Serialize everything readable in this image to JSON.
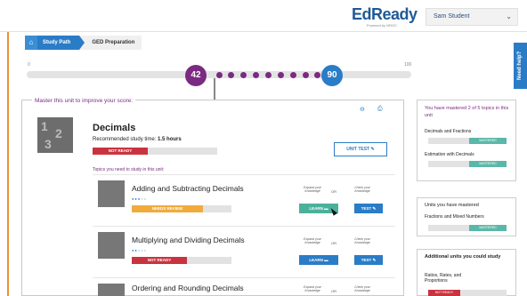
{
  "header": {
    "logo": "EdReady",
    "logo_sub": "Powered by NROC",
    "user_name": "Sam Student",
    "user_chevron_icon": "chevron-down-icon"
  },
  "breadcrumb": {
    "home_icon": "home-icon",
    "path": "Study Path",
    "current": "GED Preparation"
  },
  "need_help": "Need help?",
  "progress": {
    "min_label": "0",
    "max_label": "100",
    "current_score": "42",
    "target_score": "90",
    "marker_count": 9
  },
  "master_panel": {
    "title": "Master this unit to improve your score:",
    "unit_name": "Decimals",
    "study_time_label": "Recommended study time:",
    "study_time_value": "1.5 hours",
    "status": "NOT READY",
    "unit_test_label": "UNIT TEST",
    "topics_title": "Topics you need to study in this unit:",
    "explore_label": "Expand your Knowledge",
    "check_label": "Check your Knowledge",
    "or_label": "OR",
    "topics": [
      {
        "name": "Adding and Subtracting Decimals",
        "status": "NEEDS REVIEW",
        "learn": "LEARN",
        "test": "TEST"
      },
      {
        "name": "Multiplying and Dividing Decimals",
        "status": "NOT READY",
        "learn": "LEARN",
        "test": "TEST"
      },
      {
        "name": "Ordering and Rounding Decimals",
        "status": "",
        "learn": "",
        "test": ""
      }
    ]
  },
  "sidebar": {
    "mastered_summary": "You have mastered 2 of 5 topics in this unit",
    "mastered_topics": [
      {
        "name": "Decimals and Fractions",
        "status": "MASTERED"
      },
      {
        "name": "Estimation with Decimals",
        "status": "MASTERED"
      }
    ],
    "units_mastered_title": "Units you have mastered",
    "units_mastered": [
      {
        "name": "Fractions and Mixed Numbers",
        "status": "MASTERED"
      }
    ],
    "additional_title": "Additional units you could study",
    "additional_units": [
      {
        "name": "Ratios, Rates, and Proportions",
        "status": "NOT READY"
      }
    ]
  },
  "colors": {
    "accent_blue": "#2a7cc7",
    "purple": "#7b2a82",
    "not_ready_red": "#c9333f",
    "needs_review_orange": "#f0ab3b",
    "mastered_teal": "#5bb8a8"
  }
}
